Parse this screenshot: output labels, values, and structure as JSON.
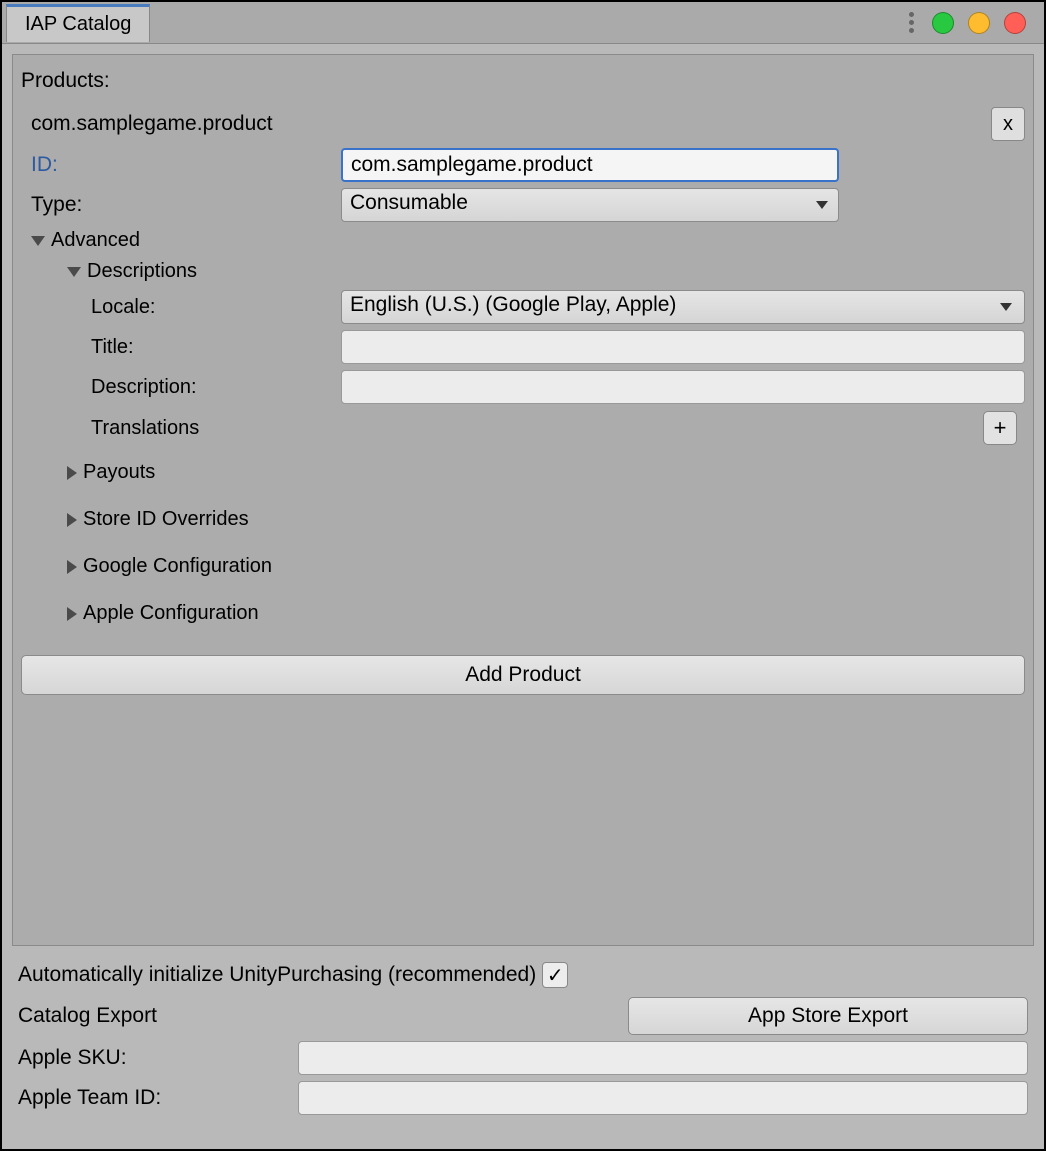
{
  "window": {
    "tab_title": "IAP Catalog"
  },
  "panel": {
    "products_header": "Products:",
    "product_name": "com.samplegame.product",
    "remove_label": "x",
    "id_label": "ID:",
    "id_value": "com.samplegame.product",
    "type_label": "Type:",
    "type_value": "Consumable",
    "advanced_label": "Advanced",
    "descriptions_label": "Descriptions",
    "locale_label": "Locale:",
    "locale_value": "English (U.S.) (Google Play, Apple)",
    "title_label": "Title:",
    "title_value": "",
    "description_label": "Description:",
    "description_value": "",
    "translations_label": "Translations",
    "add_translation_label": "+",
    "payouts_label": "Payouts",
    "store_overrides_label": "Store ID Overrides",
    "google_config_label": "Google Configuration",
    "apple_config_label": "Apple Configuration",
    "add_product_label": "Add Product"
  },
  "footer": {
    "auto_init_label": "Automatically initialize UnityPurchasing (recommended)",
    "auto_init_checked": "✓",
    "catalog_export_label": "Catalog Export",
    "app_store_export_label": "App Store Export",
    "apple_sku_label": "Apple SKU:",
    "apple_sku_value": "",
    "apple_team_id_label": "Apple Team ID:",
    "apple_team_id_value": ""
  }
}
